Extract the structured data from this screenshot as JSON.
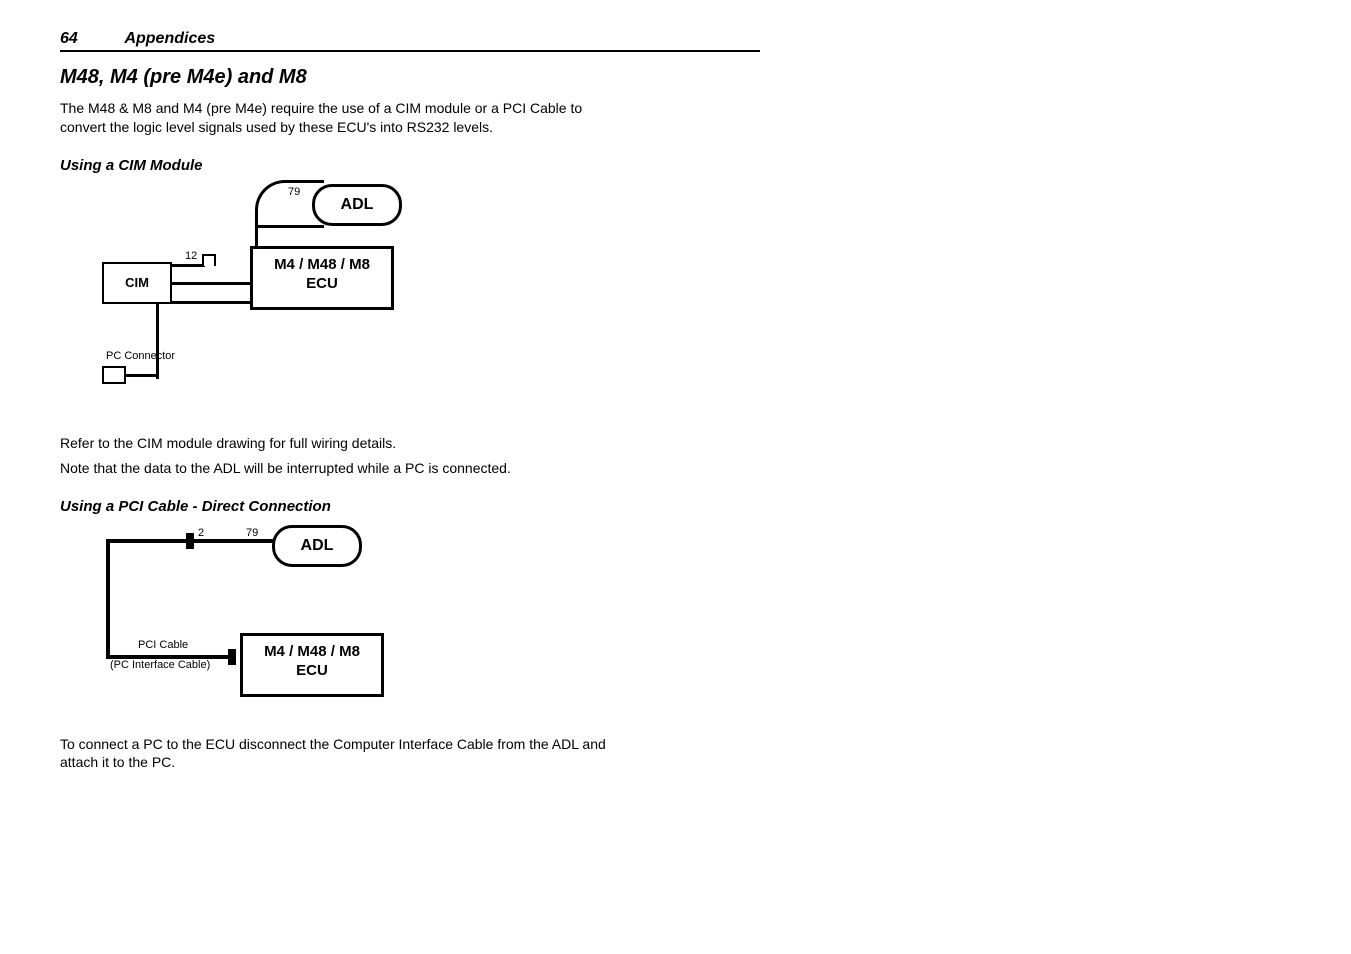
{
  "header": {
    "page_number": "64",
    "section": "Appendices"
  },
  "h1": "M48, M4 (pre M4e) and M8",
  "intro": "The M48 & M8 and M4 (pre M4e) require the use of a CIM module or a PCI Cable to convert the logic level signals used by these ECU's into RS232 levels.",
  "section_cim": {
    "heading": "Using a CIM Module",
    "diagram": {
      "adl": "ADL",
      "pin79": "79",
      "pin12": "12",
      "ecu": "M4 / M48 / M8\nECU",
      "cim": "CIM",
      "pc_connector": "PC Connector"
    },
    "note1": "Refer to the CIM module drawing for full wiring details.",
    "note2": "Note that the data to the ADL will be interrupted while a PC is connected."
  },
  "section_pci": {
    "heading": "Using a PCI Cable - Direct Connection",
    "diagram": {
      "adl": "ADL",
      "pin79": "79",
      "pin2": "2",
      "ecu": "M4 / M48 / M8\nECU",
      "pci_cable": "PCI Cable",
      "pci_sub": "(PC Interface Cable)"
    },
    "note": "To connect a PC to the ECU disconnect the Computer Interface Cable from the ADL and attach it to the PC."
  }
}
